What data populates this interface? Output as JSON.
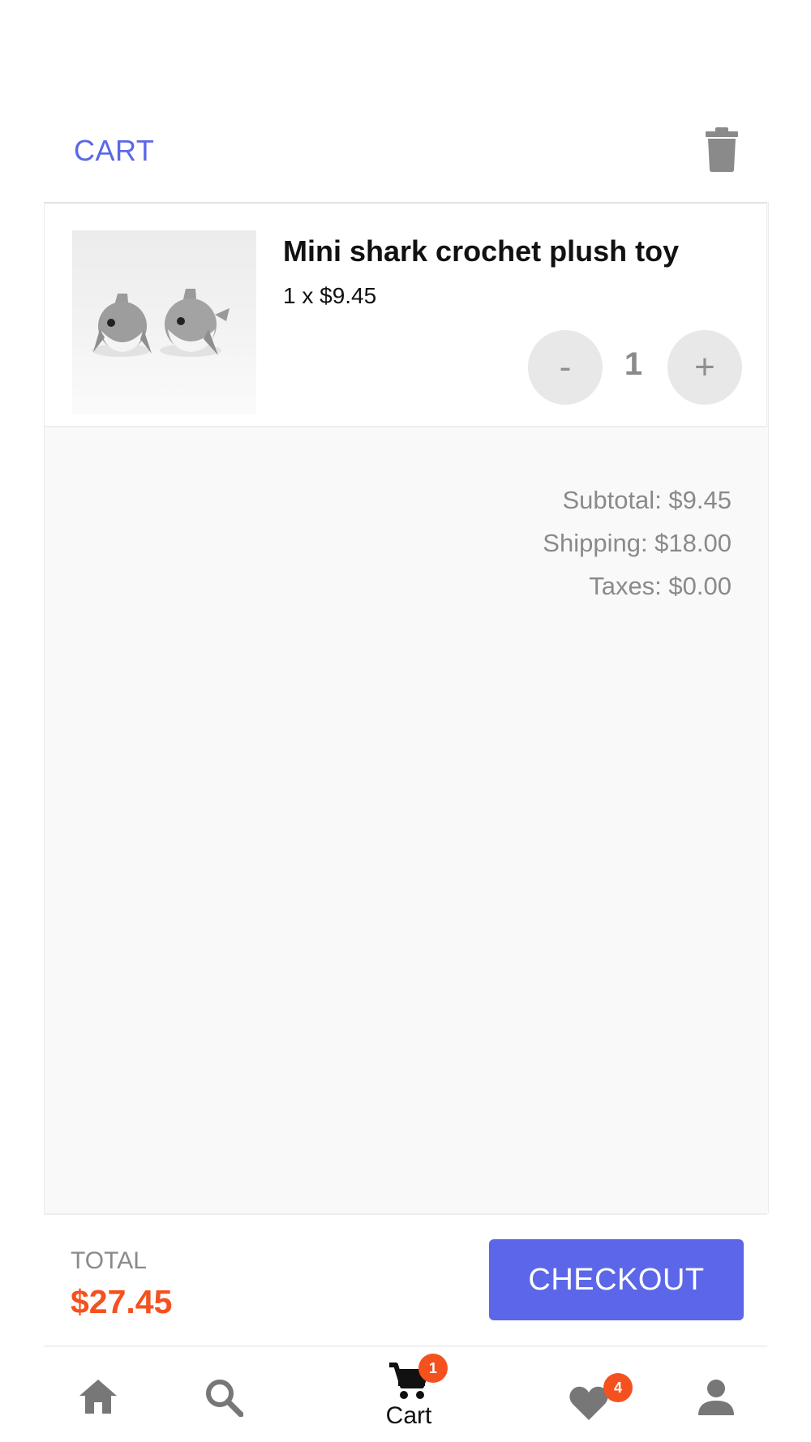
{
  "header": {
    "title": "CART"
  },
  "cart_item": {
    "name": "Mini shark crochet plush toy",
    "price_line": "1 x $9.45",
    "quantity": "1",
    "minus_label": "-",
    "plus_label": "+"
  },
  "summary": {
    "subtotal": "Subtotal: $9.45",
    "shipping": "Shipping: $18.00",
    "taxes": "Taxes: $0.00"
  },
  "total": {
    "label": "TOTAL",
    "value": "$27.45"
  },
  "checkout": {
    "label": "CHECKOUT"
  },
  "bottom_nav": {
    "items": [
      {
        "icon": "home-icon"
      },
      {
        "icon": "search-icon"
      },
      {
        "icon": "cart-icon",
        "label": "Cart",
        "badge": "1"
      },
      {
        "icon": "heart-icon",
        "badge": "4"
      },
      {
        "icon": "person-icon"
      }
    ]
  },
  "colors": {
    "accent": "#5b67e8",
    "price_highlight": "#f4511e",
    "badge": "#f4511e"
  }
}
